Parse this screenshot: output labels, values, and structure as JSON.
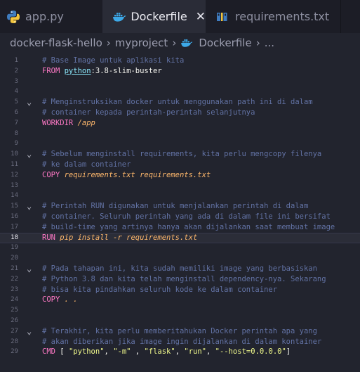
{
  "tabs": [
    {
      "label": "app.py",
      "icon": "python-icon"
    },
    {
      "label": "Dockerfile",
      "icon": "docker-icon",
      "active": true
    },
    {
      "label": "requirements.txt",
      "icon": "pip-icon"
    }
  ],
  "breadcrumb": {
    "folder": "docker-flask-hello",
    "subfolder": "myproject",
    "file": "Dockerfile",
    "more": "..."
  },
  "code": {
    "active_line": 18,
    "lines": [
      {
        "n": "1",
        "fold": false,
        "parts": [
          {
            "t": "# Base Image untuk aplikasi kita",
            "c": "cm"
          }
        ]
      },
      {
        "n": "2",
        "fold": false,
        "parts": [
          {
            "t": "FROM ",
            "c": "kw"
          },
          {
            "t": "python",
            "c": "img"
          },
          {
            "t": ":3.8-slim-buster",
            "c": "tag"
          }
        ]
      },
      {
        "n": "3",
        "fold": false,
        "parts": []
      },
      {
        "n": "4",
        "fold": false,
        "parts": []
      },
      {
        "n": "5",
        "fold": true,
        "parts": [
          {
            "t": "# Menginstruksikan docker untuk menggunakan path ini di dalam",
            "c": "cm"
          }
        ]
      },
      {
        "n": "6",
        "fold": false,
        "parts": [
          {
            "t": "# container kepada perintah-perintah selanjutnya",
            "c": "cm"
          }
        ]
      },
      {
        "n": "7",
        "fold": false,
        "parts": [
          {
            "t": "WORKDIR ",
            "c": "kw"
          },
          {
            "t": "/app",
            "c": "arg"
          }
        ]
      },
      {
        "n": "8",
        "fold": false,
        "parts": []
      },
      {
        "n": "9",
        "fold": false,
        "parts": []
      },
      {
        "n": "10",
        "fold": true,
        "parts": [
          {
            "t": "# Sebelum menginstall requirements, kita perlu mengcopy filenya",
            "c": "cm"
          }
        ]
      },
      {
        "n": "11",
        "fold": false,
        "parts": [
          {
            "t": "# ke dalam container",
            "c": "cm"
          }
        ]
      },
      {
        "n": "12",
        "fold": false,
        "parts": [
          {
            "t": "COPY ",
            "c": "kw"
          },
          {
            "t": "requirements.txt requirements.txt",
            "c": "arg"
          }
        ]
      },
      {
        "n": "13",
        "fold": false,
        "parts": []
      },
      {
        "n": "14",
        "fold": false,
        "parts": []
      },
      {
        "n": "15",
        "fold": true,
        "parts": [
          {
            "t": "# Perintah RUN digunakan untuk menjalankan perintah di dalam",
            "c": "cm"
          }
        ]
      },
      {
        "n": "16",
        "fold": false,
        "parts": [
          {
            "t": "# container. Seluruh perintah yang ada di dalam file ini bersifat",
            "c": "cm"
          }
        ]
      },
      {
        "n": "17",
        "fold": false,
        "parts": [
          {
            "t": "# build-time yang artinya hanya akan dijalankan saat membuat image",
            "c": "cm"
          }
        ]
      },
      {
        "n": "18",
        "fold": false,
        "parts": [
          {
            "t": "RUN ",
            "c": "kw"
          },
          {
            "t": "pip install -r requirements.txt",
            "c": "arg"
          }
        ]
      },
      {
        "n": "19",
        "fold": false,
        "parts": []
      },
      {
        "n": "20",
        "fold": false,
        "parts": []
      },
      {
        "n": "21",
        "fold": true,
        "parts": [
          {
            "t": "# Pada tahapan ini, kita sudah memiliki image yang berbasiskan",
            "c": "cm"
          }
        ]
      },
      {
        "n": "22",
        "fold": false,
        "parts": [
          {
            "t": "# Python 3.8 dan kita telah menginstall dependency-nya. Sekarang",
            "c": "cm"
          }
        ]
      },
      {
        "n": "23",
        "fold": false,
        "parts": [
          {
            "t": "# bisa kita pindahkan seluruh kode ke dalam container",
            "c": "cm"
          }
        ]
      },
      {
        "n": "24",
        "fold": false,
        "parts": [
          {
            "t": "COPY ",
            "c": "kw"
          },
          {
            "t": ". .",
            "c": "arg"
          }
        ]
      },
      {
        "n": "25",
        "fold": false,
        "parts": []
      },
      {
        "n": "26",
        "fold": false,
        "parts": []
      },
      {
        "n": "27",
        "fold": true,
        "parts": [
          {
            "t": "# Terakhir, kita perlu memberitahukan Docker perintah apa yang",
            "c": "cm"
          }
        ]
      },
      {
        "n": "28",
        "fold": false,
        "parts": [
          {
            "t": "# akan diberikan jika image ingin dijalankan di dalam kontainer",
            "c": "cm"
          }
        ]
      },
      {
        "n": "29",
        "fold": false,
        "parts": [
          {
            "t": "CMD ",
            "c": "kw"
          },
          {
            "t": "[ ",
            "c": "plain"
          },
          {
            "t": "\"python\"",
            "c": "str"
          },
          {
            "t": ", ",
            "c": "plain"
          },
          {
            "t": "\"-m\"",
            "c": "str"
          },
          {
            "t": " , ",
            "c": "plain"
          },
          {
            "t": "\"flask\"",
            "c": "str"
          },
          {
            "t": ", ",
            "c": "plain"
          },
          {
            "t": "\"run\"",
            "c": "str"
          },
          {
            "t": ", ",
            "c": "plain"
          },
          {
            "t": "\"--host=0.0.0.0\"",
            "c": "str"
          },
          {
            "t": "]",
            "c": "plain"
          }
        ]
      }
    ]
  },
  "colors": {
    "background": "#22242e",
    "tabbar": "#1c1d26",
    "comment": "#6272a4",
    "keyword": "#ff79c6",
    "string": "#f1fa8c",
    "argument": "#ffb86c"
  }
}
